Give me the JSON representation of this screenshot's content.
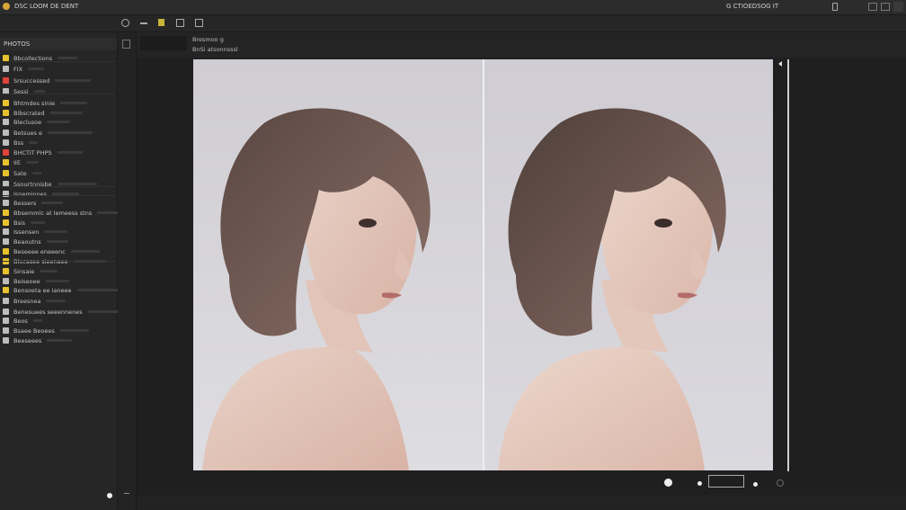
{
  "titlebar": {
    "menu": "DSC LOOM DE DENT",
    "right_text": "G CTIOEDSOG IT",
    "right_icons": [
      "window-min-icon",
      "window-max-icon",
      "window-close-icon"
    ]
  },
  "toolbar": {
    "tools": [
      "zoom-icon",
      "minus-icon",
      "tag-icon",
      "grid-icon",
      "layout-icon"
    ]
  },
  "sidebar": {
    "header": "PHOTOS",
    "items": [
      {
        "label": "Bbcollections",
        "color": "#e8c22e"
      },
      {
        "label": "FIX",
        "color": "#bdbdbd"
      },
      {
        "label": "Srsuccessed",
        "color": "#e0443a"
      },
      {
        "label": "Sessi",
        "color": "#bdbdbd"
      },
      {
        "label": "Bhtmdes sinie",
        "color": "#e8c22e"
      },
      {
        "label": "Bibscrated",
        "color": "#e8c22e"
      },
      {
        "label": "Bleclusoe",
        "color": "#bdbdbd"
      },
      {
        "label": "Betsues e",
        "color": "#bdbdbd"
      },
      {
        "label": "Bss",
        "color": "#bdbdbd"
      },
      {
        "label": "BHCTIT PHPS",
        "color": "#e0443a"
      },
      {
        "label": "IIE",
        "color": "#e8c22e"
      },
      {
        "label": "Sate",
        "color": "#e8c22e"
      },
      {
        "label": "Ssnurtnnisbe",
        "color": "#bdbdbd"
      },
      {
        "label": "Isneminoes",
        "color": "#bdbdbd"
      },
      {
        "label": "Bessers",
        "color": "#bdbdbd"
      },
      {
        "label": "Bbsemmlc at Iemeess stns",
        "color": "#e8c22e"
      },
      {
        "label": "Bsis",
        "color": "#e8c22e"
      },
      {
        "label": "Issensen",
        "color": "#bdbdbd"
      },
      {
        "label": "Beaoutns",
        "color": "#bdbdbd"
      },
      {
        "label": "Beseeee eneeenc",
        "color": "#e8c22e"
      },
      {
        "label": "Blocasee sieenaee",
        "color": "#e8c22e"
      },
      {
        "label": "Sinsaie",
        "color": "#e8c22e"
      },
      {
        "label": "Beiseoee",
        "color": "#bdbdbd"
      },
      {
        "label": "Bensoeta ee ianeee",
        "color": "#e8c22e"
      },
      {
        "label": "Breesnea",
        "color": "#bdbdbd"
      },
      {
        "label": "Benesuees seeennenes",
        "color": "#bdbdbd"
      },
      {
        "label": "Beos",
        "color": "#bdbdbd"
      },
      {
        "label": "Bsaee Beoees",
        "color": "#bdbdbd"
      },
      {
        "label": "Beeseees",
        "color": "#bdbdbd"
      }
    ]
  },
  "info": {
    "line1": "Bresmoo g",
    "line2": "BnSi atsonnsssl"
  },
  "bottom": {
    "zoom_field": ""
  },
  "colors": {
    "accent_yellow": "#e8c22e",
    "accent_red": "#e0443a",
    "photo_bg": "#d3d1d6"
  }
}
